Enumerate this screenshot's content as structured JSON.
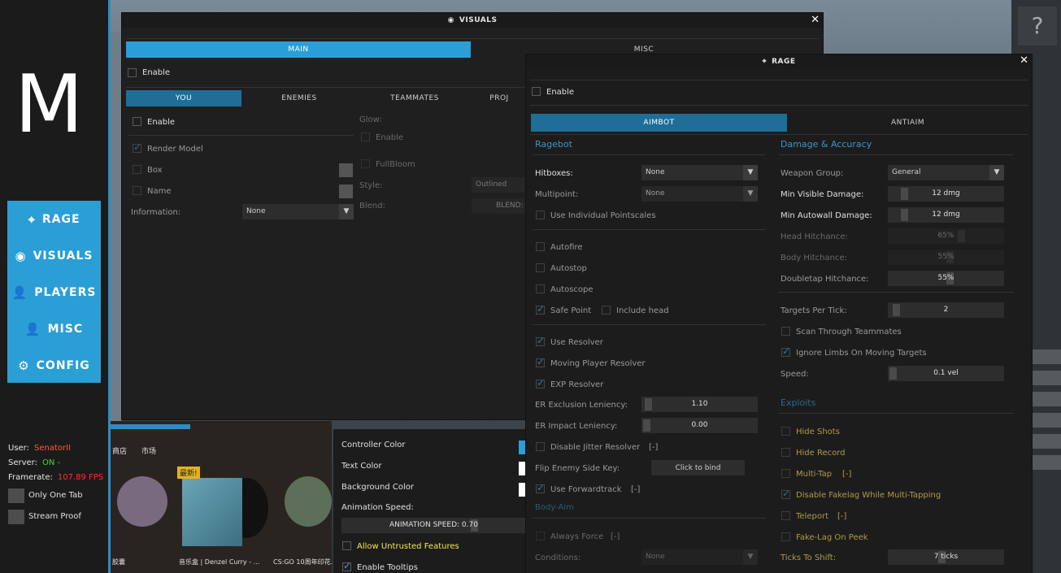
{
  "colors": {
    "accent": "#2b9ed6",
    "sidebar": "#1b1b1b",
    "user": "#ff5a3c",
    "server_on": "#4cd137",
    "framerate": "#ff3030",
    "gold": "#b09a4a"
  },
  "sidebar": {
    "logo": "M",
    "nav": [
      {
        "icon": "crosshair-icon",
        "glyph": "⌖",
        "label": "RAGE"
      },
      {
        "icon": "eye-icon",
        "glyph": "◉",
        "label": "VISUALS"
      },
      {
        "icon": "user-icon",
        "glyph": "👤",
        "label": "PLAYERS"
      },
      {
        "icon": "user-icon",
        "glyph": "👤",
        "label": "MISC"
      },
      {
        "icon": "gears-icon",
        "glyph": "⚙",
        "label": "CONFIG"
      }
    ],
    "user_label": "User:",
    "user_value": "SenatorII",
    "server_label": "Server:",
    "server_value": "ON -",
    "framerate_label": "Framerate:",
    "framerate_value": "107.89 FPS",
    "only_one_tab": "Only One Tab",
    "stream_proof": "Stream Proof"
  },
  "store": {
    "tab1": "商店",
    "tab2": "市场",
    "badge": "最新!",
    "item1": "胶囊",
    "item2": "音乐盒 | Denzel Curry - ...",
    "item3": "CS:GO 10周年印花..."
  },
  "visuals": {
    "title": "VISUALS",
    "tab_main": "MAIN",
    "tab_misc": "MISC",
    "enable": "Enable",
    "subtabs": [
      "YOU",
      "ENEMIES",
      "TEAMMATES",
      "PROJ"
    ],
    "you_enable": "Enable",
    "render_model": "Render Model",
    "box": "Box",
    "name": "Name",
    "information": "Information:",
    "information_value": "None",
    "glow": "Glow:",
    "glow_enable": "Enable",
    "fullbloom": "FullBloom",
    "style": "Style:",
    "style_value": "Outlined",
    "blend": "Blend:",
    "blend_value": "BLEND:"
  },
  "misc_settings": {
    "controller_color": "Controller Color",
    "text_color": "Text Color",
    "background_color": "Background Color",
    "animation_speed": "Animation Speed:",
    "animation_speed_slider": "ANIMATION SPEED: 0.70",
    "animation_speed_value": 0.7,
    "allow_untrusted": "Allow Untrusted Features",
    "enable_tooltips": "Enable Tooltips"
  },
  "rage": {
    "title": "RAGE",
    "enable": "Enable",
    "tab_aimbot": "AIMBOT",
    "tab_antiaim": "ANTIAIM",
    "ragebot": "Ragebot",
    "hitboxes": "Hitboxes:",
    "hitboxes_value": "None",
    "multipoint": "Multipoint:",
    "multipoint_value": "None",
    "use_individual": "Use Individual Pointscales",
    "autofire": "Autofire",
    "autostop": "Autostop",
    "autoscope": "Autoscope",
    "safe_point": "Safe Point",
    "include_head": "Include head",
    "use_resolver": "Use Resolver",
    "moving_player_resolver": "Moving Player Resolver",
    "exp_resolver": "EXP Resolver",
    "er_exclusion": "ER Exclusion Leniency:",
    "er_exclusion_value": "1.10",
    "er_impact": "ER Impact Leniency:",
    "er_impact_value": "0.00",
    "disable_jitter": "Disable Jitter Resolver",
    "disable_jitter_key": "[-]",
    "flip_enemy": "Flip Enemy Side Key:",
    "click_to_bind": "Click to bind",
    "use_forwardtrack": "Use Forwardtrack",
    "use_forwardtrack_key": "[-]",
    "body_aim": "Body-Aim",
    "always_force": "Always Force",
    "always_force_key": "[-]",
    "conditions": "Conditions:",
    "conditions_value": "None",
    "damage_accuracy": "Damage & Accuracy",
    "weapon_group": "Weapon Group:",
    "weapon_group_value": "General",
    "min_visible": "Min Visible Damage:",
    "min_visible_value": "12 dmg",
    "min_autowall": "Min Autowall Damage:",
    "min_autowall_value": "12 dmg",
    "head_hitchance": "Head Hitchance:",
    "head_hitchance_value": "65%",
    "body_hitchance": "Body Hitchance:",
    "body_hitchance_value": "55%",
    "doubletap_hitchance": "Doubletap Hitchance:",
    "doubletap_hitchance_value": "55%",
    "targets_per_tick": "Targets Per Tick:",
    "targets_per_tick_value": "2",
    "scan_through": "Scan Through Teammates",
    "ignore_limbs": "Ignore Limbs On Moving Targets",
    "speed": "Speed:",
    "speed_value": "0.1 vel",
    "exploits": "Exploits",
    "hide_shots": "Hide Shots",
    "hide_record": "Hide Record",
    "multi_tap": "Multi-Tap",
    "multi_tap_key": "[-]",
    "disable_fakelag": "Disable Fakelag While Multi-Tapping",
    "teleport": "Teleport",
    "teleport_key": "[-]",
    "fakelag_on_peek": "Fake-Lag On Peek",
    "ticks_to_shift": "Ticks To Shift:",
    "ticks_to_shift_value": "7 ticks"
  },
  "right_strip": {
    "help": "?"
  }
}
